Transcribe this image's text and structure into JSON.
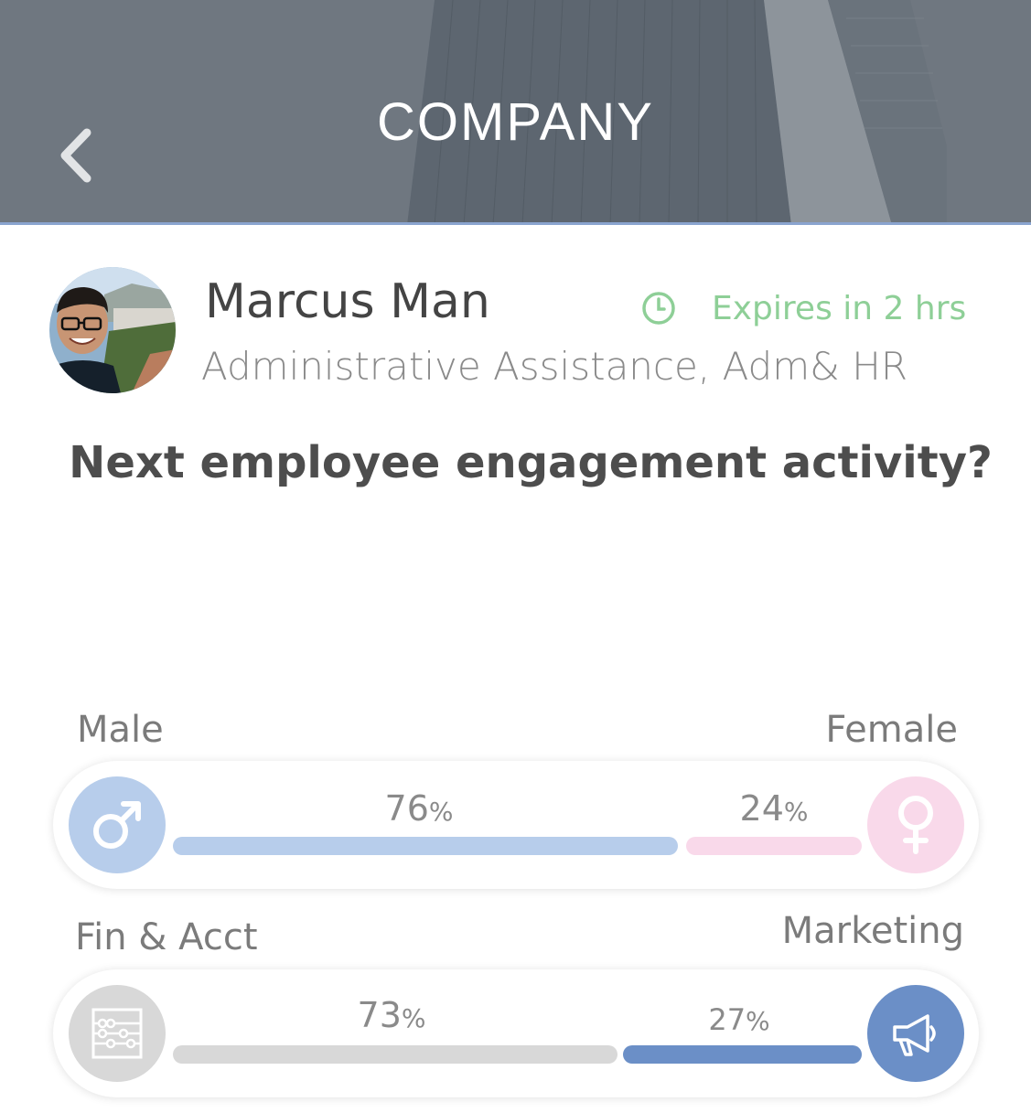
{
  "header": {
    "title": "COMPANY"
  },
  "profile": {
    "name": "Marcus Man",
    "role": "Administrative Assistance, Adm& HR",
    "expires": "Expires in 2 hrs"
  },
  "question": "Next employee engagement activity?",
  "polls": [
    {
      "left_label": "Male",
      "right_label": "Female",
      "left_value": 76,
      "right_value": 24,
      "left_pct_text": "76",
      "right_pct_text": "24",
      "percent_sign": "%",
      "left_icon": "male-symbol-icon",
      "right_icon": "female-symbol-icon",
      "left_color": "#b7cdeb",
      "right_color": "#f9d9ea"
    },
    {
      "left_label": "Fin & Acct",
      "right_label": "Marketing",
      "left_value": 73,
      "right_value": 27,
      "left_pct_text": "73",
      "right_pct_text": "27",
      "percent_sign": "%",
      "left_icon": "abacus-icon",
      "right_icon": "megaphone-icon",
      "left_color": "#d8d8d8",
      "right_color": "#6b8fc7"
    }
  ],
  "colors": {
    "accent_line": "#8aa4cf",
    "expires_green": "#8ecf97"
  }
}
